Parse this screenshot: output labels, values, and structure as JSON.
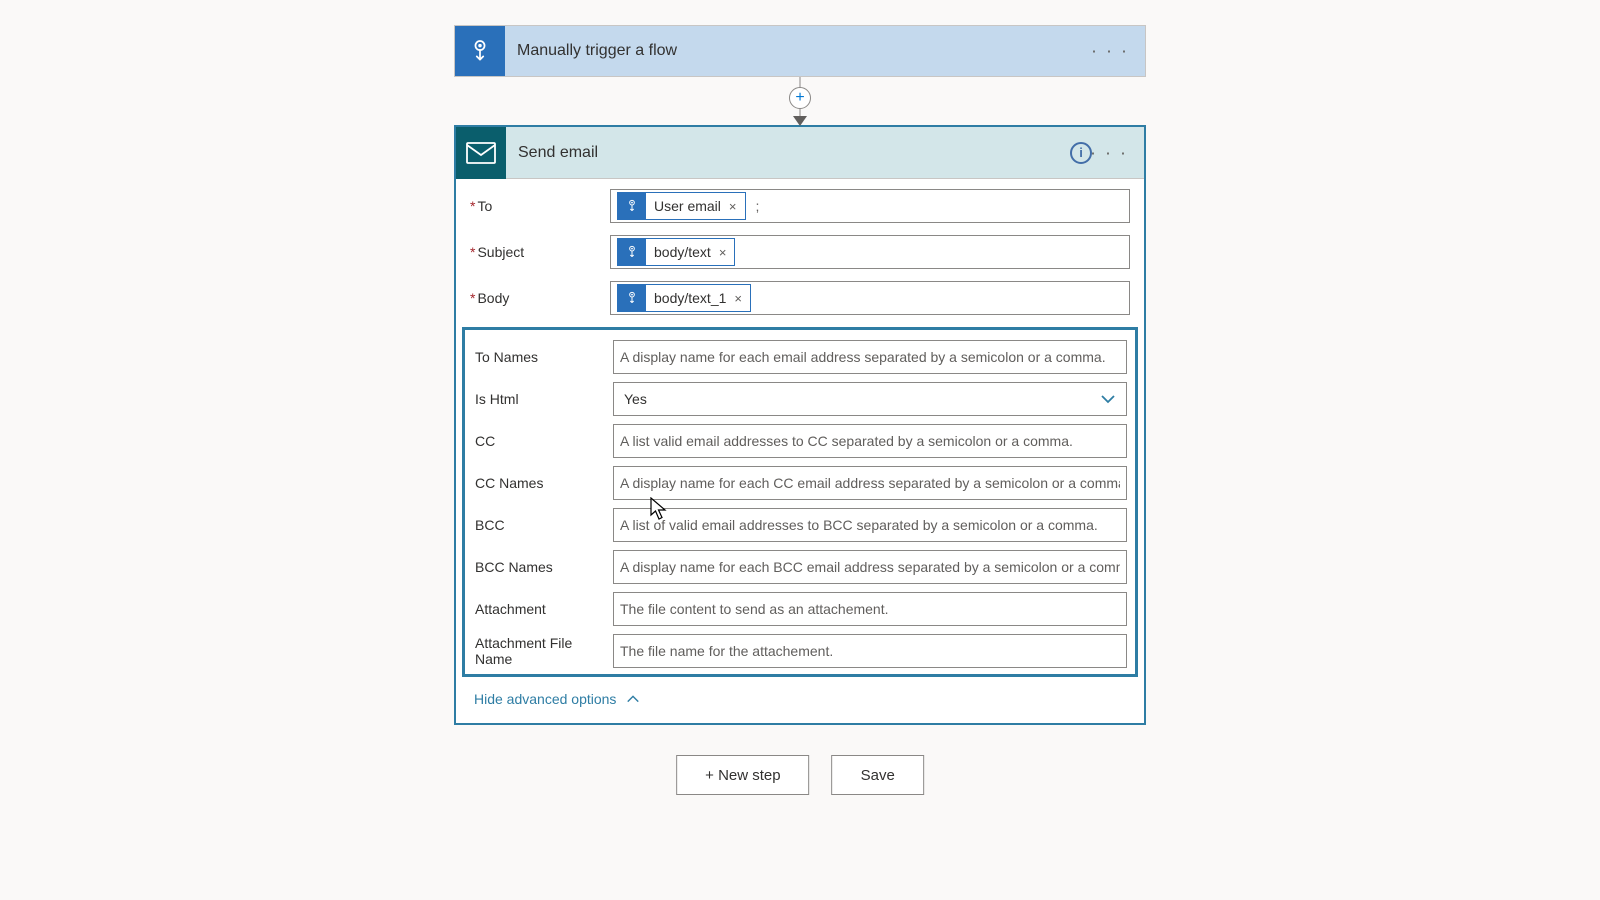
{
  "trigger": {
    "title": "Manually trigger a flow"
  },
  "action": {
    "title": "Send email",
    "fields": {
      "to": {
        "label": "To",
        "required": true,
        "token": "User email",
        "suffix": ";"
      },
      "subject": {
        "label": "Subject",
        "required": true,
        "token": "body/text"
      },
      "body": {
        "label": "Body",
        "required": true,
        "token": "body/text_1"
      }
    },
    "advanced": {
      "toNames": {
        "label": "To Names",
        "placeholder": "A display name for each email address separated by a semicolon or a comma."
      },
      "isHtml": {
        "label": "Is Html",
        "value": "Yes"
      },
      "cc": {
        "label": "CC",
        "placeholder": "A list valid email addresses to CC separated by a semicolon or a comma."
      },
      "ccNames": {
        "label": "CC Names",
        "placeholder": "A display name for each CC email address separated by a semicolon or a comma."
      },
      "bcc": {
        "label": "BCC",
        "placeholder": "A list of valid email addresses to BCC separated by a semicolon or a comma."
      },
      "bccNames": {
        "label": "BCC Names",
        "placeholder": "A display name for each BCC email address separated by a semicolon or a comma."
      },
      "attachment": {
        "label": "Attachment",
        "placeholder": "The file content to send as an attachement."
      },
      "attachmentFileName": {
        "label": "Attachment File Name",
        "placeholder": "The file name for the attachement."
      }
    },
    "hideAdvanced": "Hide advanced options"
  },
  "footer": {
    "newStep": "+ New step",
    "save": "Save"
  }
}
